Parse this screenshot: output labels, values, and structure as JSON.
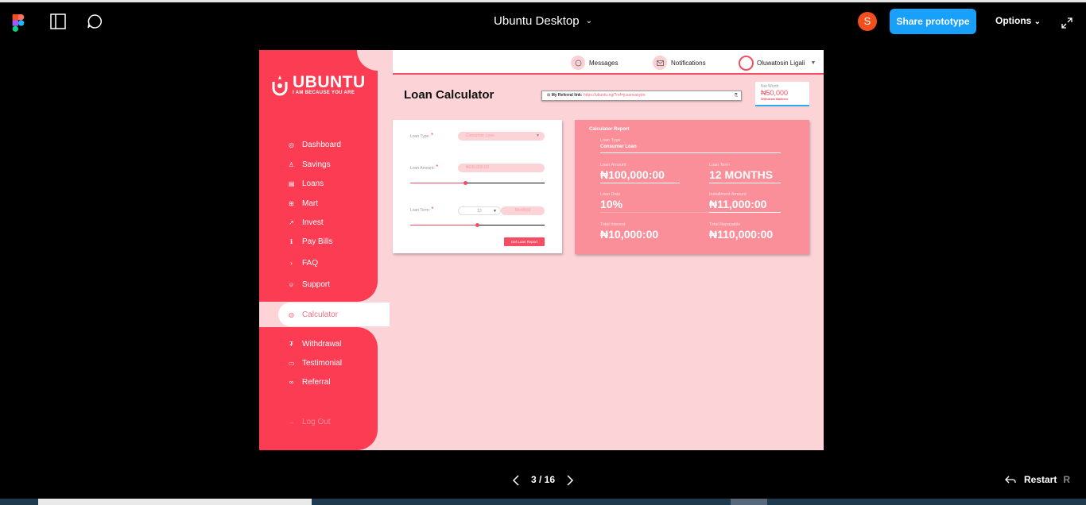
{
  "toolbar": {
    "file_title": "Ubuntu Desktop",
    "user_initial": "S",
    "share_label": "Share prototype",
    "options_label": "Options",
    "icons": [
      "figma-logo",
      "sidebar-toggle-icon",
      "comment-icon",
      "chevron-down-icon",
      "expand-icon"
    ]
  },
  "app": {
    "brand_name": "UBUNTU",
    "brand_tagline": "I AM BECAUSE YOU ARE",
    "accent_color": "#fc3c52",
    "nav": {
      "dashboard": "Dashboard",
      "savings": "Savings",
      "loans": "Loans",
      "mart": "Mart",
      "invest": "Invest",
      "pay_bills": "Pay Bills",
      "faq": "FAQ",
      "support": "Support",
      "calculator": "Calculator",
      "withdrawal": "Withdrawal",
      "testimonial": "Testimonial",
      "referral": "Referral",
      "logout": "Log Out"
    },
    "header": {
      "messages": "Messages",
      "notifications": "Notifications",
      "user_name": "Oluwatosin Ligali"
    },
    "page_title": "Loan Calculator",
    "referral": {
      "label": "My Referral link:",
      "url": "https://ubuntu.ng/?ref=jcsanvanyim"
    },
    "net_worth": {
      "label": "Net Worth",
      "value": "₦50,000",
      "withdraw": "Withdraw Balance"
    },
    "form": {
      "loan_type_label": "Loan Type:",
      "loan_type_value": "Consumer Loan",
      "loan_amount_label": "Loan Amount:",
      "loan_amount_value": "₦100,000.00",
      "loan_amount_slider": 0.41,
      "loan_term_label": "Loan Term:",
      "loan_term_value": "12",
      "loan_term_unit": "Month(s)",
      "loan_term_slider": 0.5,
      "required_mark": "*",
      "submit_label": "Get Loan Report"
    },
    "report": {
      "title": "Calculator Report",
      "loan_type_label": "Loan Type",
      "loan_type_value": "Consumer Loan",
      "loan_amount_label": "Loan Amount",
      "loan_amount_value": "₦100,000:00",
      "loan_term_label": "Loan Term",
      "loan_term_value": "12 MONTHS",
      "loan_rate_label": "Loan Rate",
      "loan_rate_value": "10%",
      "installment_label": "Installment Amount",
      "installment_value": "₦11,000:00",
      "total_interest_label": "Total Interest",
      "total_interest_value": "₦10,000:00",
      "total_repayable_label": "Total Repayable",
      "total_repayable_value": "₦110,000:00"
    }
  },
  "pager": {
    "current": "3",
    "separator": " / ",
    "total": "16"
  },
  "restart": {
    "label": "Restart",
    "shortcut": "R"
  }
}
